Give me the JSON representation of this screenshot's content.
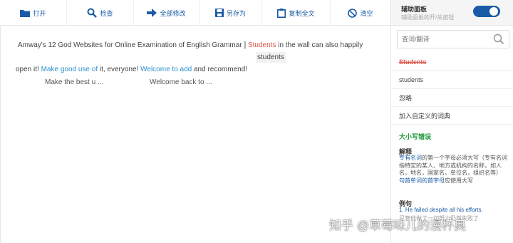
{
  "toolbar": {
    "open": "打开",
    "check": "检查",
    "modify_all": "全部修改",
    "save_as": "另存为",
    "copy_all": "复制全文",
    "clear": "清空"
  },
  "editor": {
    "line1_start": "Amway's 12 God Websites for Online Examination of English Grammar ]",
    "error_word": "Students",
    "line1_end": "in the wall can also happily",
    "suggestion": "students",
    "line2_start": "open it!",
    "link1": "Make good use of",
    "line2_mid": "it, everyone!",
    "link2": "Welcome to add",
    "line2_end": "and recommend!",
    "preview1": "Make the best u ...",
    "preview2": "Welcome back to ..."
  },
  "panel": {
    "title": "辅助面板",
    "subtitle": "辅助面板的开/关按钮",
    "toggle_on": true,
    "search_placeholder": "查词/翻译",
    "error_word": "Students",
    "suggestion": "students",
    "ignore": "忽略",
    "add_dict": "加入自定义的词典",
    "category": "大小写错误",
    "explain_title": "解释",
    "explain_link1": "专有名词",
    "explain_text1": "的第一个字母必须大写（专有名词指特定的某人、地方或机构的名称，如人名，地名，国家名，单位名，组织名等）",
    "explain_link2": "句首单词的首字母",
    "explain_text2": "应使用大写",
    "example_title": "例句",
    "example1": "1. He failed despite all his efforts.",
    "example2": "尽管他做了一切努力仍然失败了"
  },
  "watermark": "知乎 @草莓味儿的漫杯奥"
}
